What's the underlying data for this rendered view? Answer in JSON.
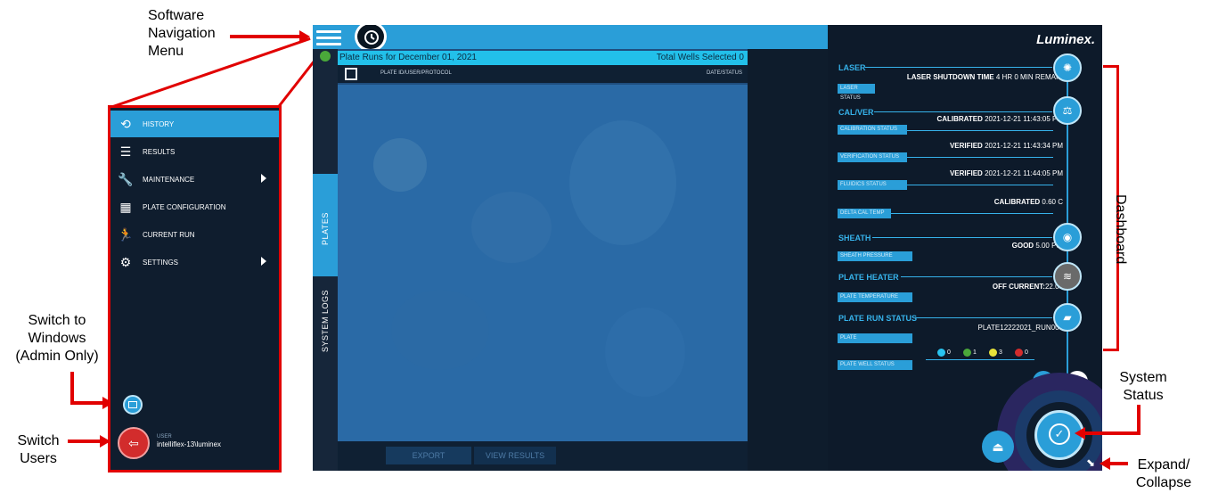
{
  "callouts": {
    "nav_menu": [
      "Software",
      "Navigation",
      "Menu"
    ],
    "switch_windows": [
      "Switch to",
      "Windows",
      "(Admin Only)"
    ],
    "switch_users": [
      "Switch",
      "Users"
    ],
    "dashboard": "Dashboard",
    "system_status": [
      "System",
      "Status"
    ],
    "expand_collapse": [
      "Expand/",
      "Collapse"
    ]
  },
  "colors": {
    "accent": "#2a9ed8",
    "callout_red": "#e10000",
    "panel_dark": "#0d1a2a",
    "header_cyan": "#22c0ea"
  },
  "icons": {
    "hamburger": "hamburger-menu-icon",
    "history": "history-icon",
    "check": "check-circle-icon",
    "eject": "eject-icon",
    "camera": "camera-icon",
    "timer": "timer-icon",
    "expand": "expand-collapse-icon"
  },
  "side_tabs": {
    "plates": "PLATES",
    "system_logs": "SYSTEM LOGS"
  },
  "plates": {
    "header_title": "Plate Runs for December 01, 2021",
    "total_wells": "Total Wells Selected 0",
    "col_plate": "PLATE ID/USER/PROTOCOL",
    "col_date": "DATE/STATUS",
    "export_button": "EXPORT",
    "view_results_button": "VIEW RESULTS"
  },
  "nav_menu": {
    "items": [
      {
        "label": "HISTORY",
        "icon": "history-icon",
        "submenu": false,
        "active": true
      },
      {
        "label": "RESULTS",
        "icon": "list-icon",
        "submenu": false,
        "active": false
      },
      {
        "label": "MAINTENANCE",
        "icon": "wrench-icon",
        "submenu": true,
        "active": false
      },
      {
        "label": "PLATE CONFIGURATION",
        "icon": "grid-icon",
        "submenu": false,
        "active": false
      },
      {
        "label": "CURRENT RUN",
        "icon": "running-icon",
        "submenu": false,
        "active": false
      },
      {
        "label": "SETTINGS",
        "icon": "gear-icon",
        "submenu": true,
        "active": false
      }
    ],
    "user_role": "USER",
    "user_name": "intelliflex-13\\luminex"
  },
  "dashboard": {
    "brand": "Luminex.",
    "laser": {
      "title": "LASER",
      "value_label": "LASER SHUTDOWN TIME",
      "value": "4 HR 0 MIN REMAIN",
      "status_label": "LASER STATUS"
    },
    "calver": {
      "title": "CAL/VER",
      "calibration": {
        "value_label": "CALIBRATED",
        "value": "2021-12-21 11:43:05 PM",
        "status_label": "CALIBRATION STATUS"
      },
      "verification": {
        "value_label": "VERIFIED",
        "value": "2021-12-21 11:43:34 PM",
        "status_label": "VERIFICATION STATUS"
      },
      "fluidics": {
        "value_label": "VERIFIED",
        "value": "2021-12-21 11:44:05 PM",
        "status_label": "FLUIDICS STATUS"
      },
      "delta": {
        "value_label": "CALIBRATED",
        "value": "0.60 C",
        "status_label": "DELTA CAL TEMP"
      }
    },
    "sheath": {
      "title": "SHEATH",
      "value_label": "GOOD",
      "value": "5.00 PSI",
      "status_label": "SHEATH PRESSURE"
    },
    "plate_heater": {
      "title": "PLATE HEATER",
      "value_label": "OFF CURRENT:",
      "value": "22.00",
      "status_label": "PLATE TEMPERATURE"
    },
    "plate_run": {
      "title": "PLATE RUN STATUS",
      "value": "PLATE12222021_RUN000",
      "status_label": "PLATE",
      "well_status_label": "PLATE WELL STATUS"
    },
    "well_counts": [
      {
        "color": "#29c4f0",
        "count": "0"
      },
      {
        "color": "#4aa83a",
        "count": "1"
      },
      {
        "color": "#e8e23a",
        "count": "3"
      },
      {
        "color": "#d22c2c",
        "count": "0"
      }
    ]
  }
}
